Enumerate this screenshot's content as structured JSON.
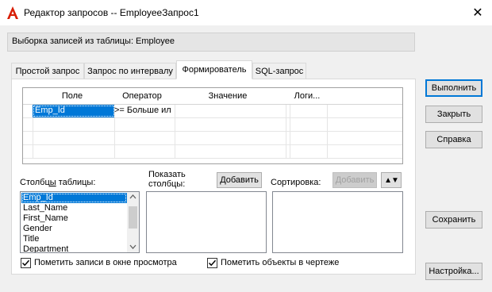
{
  "window": {
    "title": "Редактор запросов -- EmployeeЗапрос1",
    "close_glyph": "✕"
  },
  "info": {
    "text": "Выборка записей из таблицы:  Employee"
  },
  "tabs": [
    {
      "label": "Простой запрос"
    },
    {
      "label": "Запрос по интервалу"
    },
    {
      "label": "Формирователь"
    },
    {
      "label": "SQL-запрос"
    }
  ],
  "grid": {
    "headers": [
      "Поле",
      "Оператор",
      "Значение",
      "Логи..."
    ],
    "row1": {
      "field": "Emp_Id",
      "operator": ">=  Больше ил",
      "value": "",
      "logic": ""
    }
  },
  "columns": {
    "label_prefix": "Столбц",
    "label_underlined": "ы",
    "label_suffix": " таблицы:",
    "items": [
      "Emp_Id",
      "Last_Name",
      "First_Name",
      "Gender",
      "Title",
      "Department"
    ]
  },
  "show_columns": {
    "label_line1": "Показать",
    "label_line2": "столбцы:",
    "add_label": "Добавить"
  },
  "sort": {
    "label": "Сортировка:",
    "add_label": "Добавить",
    "order_glyph": "▲▼"
  },
  "checkboxes": {
    "mark_view": {
      "label": "Пометить записи в окне просмотра",
      "checked": true
    },
    "mark_drawing": {
      "label": "Пометить объекты в чертеже",
      "checked": true
    }
  },
  "buttons": {
    "execute": "Выполнить",
    "close": "Закрыть",
    "help": "Справка",
    "save": "Сохранить",
    "settings": "Настройка..."
  },
  "colors": {
    "accent": "#0078d7",
    "logo": "#d81e05"
  }
}
